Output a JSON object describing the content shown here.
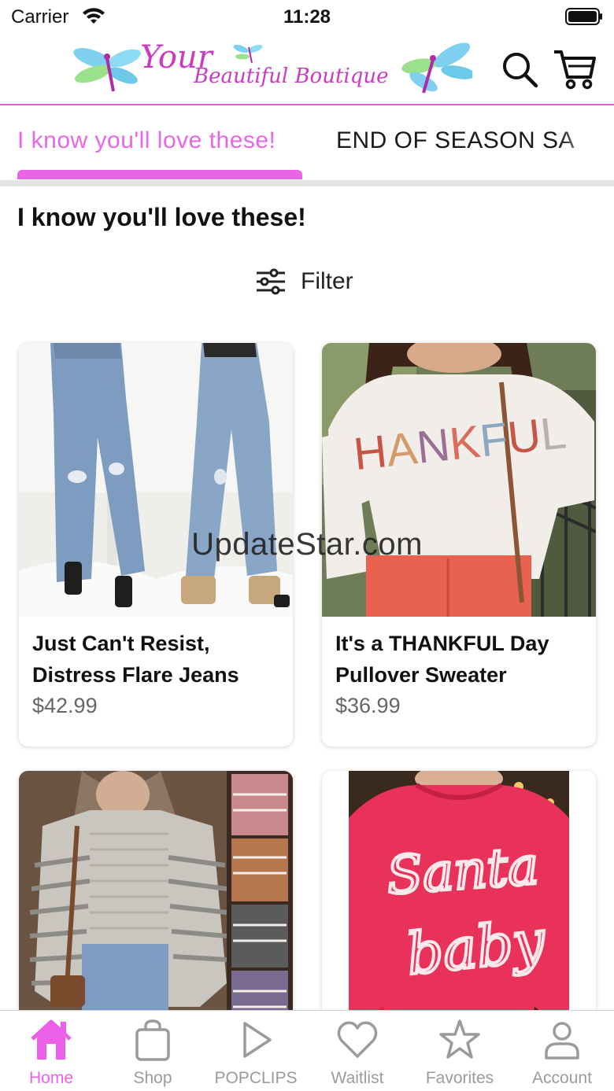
{
  "status_bar": {
    "carrier": "Carrier",
    "time": "11:28"
  },
  "header": {
    "logo_line1": "Your",
    "logo_line2": "Beautiful Boutique",
    "accent_color": "#c93bbf"
  },
  "tabs": [
    {
      "label": "I know you'll love these!",
      "active": true
    },
    {
      "label": "END OF SEASON SA",
      "active": false
    }
  ],
  "page": {
    "title": "I know you'll love these!",
    "filter_label": "Filter"
  },
  "products": [
    {
      "name": "Just Can't Resist, Distress Flare Jeans",
      "price": "$42.99",
      "image": "jeans-photo"
    },
    {
      "name": "It's a THANKFUL Day Pullover Sweater",
      "price": "$36.99",
      "image": "thankful-sweater-photo"
    },
    {
      "name": "",
      "price": "",
      "image": "striped-sweater-photo"
    },
    {
      "name": "",
      "price": "",
      "image": "santa-baby-sweater-photo"
    }
  ],
  "watermark": "UpdateStar.com",
  "tabbar": [
    {
      "label": "Home",
      "icon": "home-icon",
      "active": true
    },
    {
      "label": "Shop",
      "icon": "shopping-bag-icon",
      "active": false
    },
    {
      "label": "POPCLIPS",
      "icon": "play-icon",
      "active": false
    },
    {
      "label": "Waitlist",
      "icon": "heart-icon",
      "active": false
    },
    {
      "label": "Favorites",
      "icon": "star-icon",
      "active": false
    },
    {
      "label": "Account",
      "icon": "person-icon",
      "active": false
    }
  ],
  "colors": {
    "accent": "#e866e6",
    "active_tab_label": "#ec5fe8",
    "inactive": "#9b9b9b"
  }
}
